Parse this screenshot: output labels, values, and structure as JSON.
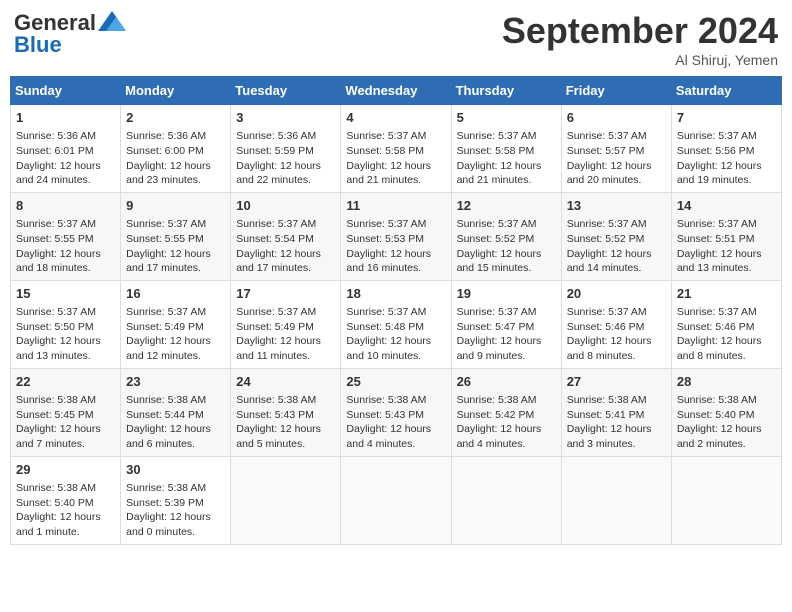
{
  "header": {
    "logo_general": "General",
    "logo_blue": "Blue",
    "month_title": "September 2024",
    "location": "Al Shiruj, Yemen"
  },
  "columns": [
    "Sunday",
    "Monday",
    "Tuesday",
    "Wednesday",
    "Thursday",
    "Friday",
    "Saturday"
  ],
  "weeks": [
    [
      {
        "day": "1",
        "sunrise": "Sunrise: 5:36 AM",
        "sunset": "Sunset: 6:01 PM",
        "daylight": "Daylight: 12 hours and 24 minutes."
      },
      {
        "day": "2",
        "sunrise": "Sunrise: 5:36 AM",
        "sunset": "Sunset: 6:00 PM",
        "daylight": "Daylight: 12 hours and 23 minutes."
      },
      {
        "day": "3",
        "sunrise": "Sunrise: 5:36 AM",
        "sunset": "Sunset: 5:59 PM",
        "daylight": "Daylight: 12 hours and 22 minutes."
      },
      {
        "day": "4",
        "sunrise": "Sunrise: 5:37 AM",
        "sunset": "Sunset: 5:58 PM",
        "daylight": "Daylight: 12 hours and 21 minutes."
      },
      {
        "day": "5",
        "sunrise": "Sunrise: 5:37 AM",
        "sunset": "Sunset: 5:58 PM",
        "daylight": "Daylight: 12 hours and 21 minutes."
      },
      {
        "day": "6",
        "sunrise": "Sunrise: 5:37 AM",
        "sunset": "Sunset: 5:57 PM",
        "daylight": "Daylight: 12 hours and 20 minutes."
      },
      {
        "day": "7",
        "sunrise": "Sunrise: 5:37 AM",
        "sunset": "Sunset: 5:56 PM",
        "daylight": "Daylight: 12 hours and 19 minutes."
      }
    ],
    [
      {
        "day": "8",
        "sunrise": "Sunrise: 5:37 AM",
        "sunset": "Sunset: 5:55 PM",
        "daylight": "Daylight: 12 hours and 18 minutes."
      },
      {
        "day": "9",
        "sunrise": "Sunrise: 5:37 AM",
        "sunset": "Sunset: 5:55 PM",
        "daylight": "Daylight: 12 hours and 17 minutes."
      },
      {
        "day": "10",
        "sunrise": "Sunrise: 5:37 AM",
        "sunset": "Sunset: 5:54 PM",
        "daylight": "Daylight: 12 hours and 17 minutes."
      },
      {
        "day": "11",
        "sunrise": "Sunrise: 5:37 AM",
        "sunset": "Sunset: 5:53 PM",
        "daylight": "Daylight: 12 hours and 16 minutes."
      },
      {
        "day": "12",
        "sunrise": "Sunrise: 5:37 AM",
        "sunset": "Sunset: 5:52 PM",
        "daylight": "Daylight: 12 hours and 15 minutes."
      },
      {
        "day": "13",
        "sunrise": "Sunrise: 5:37 AM",
        "sunset": "Sunset: 5:52 PM",
        "daylight": "Daylight: 12 hours and 14 minutes."
      },
      {
        "day": "14",
        "sunrise": "Sunrise: 5:37 AM",
        "sunset": "Sunset: 5:51 PM",
        "daylight": "Daylight: 12 hours and 13 minutes."
      }
    ],
    [
      {
        "day": "15",
        "sunrise": "Sunrise: 5:37 AM",
        "sunset": "Sunset: 5:50 PM",
        "daylight": "Daylight: 12 hours and 13 minutes."
      },
      {
        "day": "16",
        "sunrise": "Sunrise: 5:37 AM",
        "sunset": "Sunset: 5:49 PM",
        "daylight": "Daylight: 12 hours and 12 minutes."
      },
      {
        "day": "17",
        "sunrise": "Sunrise: 5:37 AM",
        "sunset": "Sunset: 5:49 PM",
        "daylight": "Daylight: 12 hours and 11 minutes."
      },
      {
        "day": "18",
        "sunrise": "Sunrise: 5:37 AM",
        "sunset": "Sunset: 5:48 PM",
        "daylight": "Daylight: 12 hours and 10 minutes."
      },
      {
        "day": "19",
        "sunrise": "Sunrise: 5:37 AM",
        "sunset": "Sunset: 5:47 PM",
        "daylight": "Daylight: 12 hours and 9 minutes."
      },
      {
        "day": "20",
        "sunrise": "Sunrise: 5:37 AM",
        "sunset": "Sunset: 5:46 PM",
        "daylight": "Daylight: 12 hours and 8 minutes."
      },
      {
        "day": "21",
        "sunrise": "Sunrise: 5:37 AM",
        "sunset": "Sunset: 5:46 PM",
        "daylight": "Daylight: 12 hours and 8 minutes."
      }
    ],
    [
      {
        "day": "22",
        "sunrise": "Sunrise: 5:38 AM",
        "sunset": "Sunset: 5:45 PM",
        "daylight": "Daylight: 12 hours and 7 minutes."
      },
      {
        "day": "23",
        "sunrise": "Sunrise: 5:38 AM",
        "sunset": "Sunset: 5:44 PM",
        "daylight": "Daylight: 12 hours and 6 minutes."
      },
      {
        "day": "24",
        "sunrise": "Sunrise: 5:38 AM",
        "sunset": "Sunset: 5:43 PM",
        "daylight": "Daylight: 12 hours and 5 minutes."
      },
      {
        "day": "25",
        "sunrise": "Sunrise: 5:38 AM",
        "sunset": "Sunset: 5:43 PM",
        "daylight": "Daylight: 12 hours and 4 minutes."
      },
      {
        "day": "26",
        "sunrise": "Sunrise: 5:38 AM",
        "sunset": "Sunset: 5:42 PM",
        "daylight": "Daylight: 12 hours and 4 minutes."
      },
      {
        "day": "27",
        "sunrise": "Sunrise: 5:38 AM",
        "sunset": "Sunset: 5:41 PM",
        "daylight": "Daylight: 12 hours and 3 minutes."
      },
      {
        "day": "28",
        "sunrise": "Sunrise: 5:38 AM",
        "sunset": "Sunset: 5:40 PM",
        "daylight": "Daylight: 12 hours and 2 minutes."
      }
    ],
    [
      {
        "day": "29",
        "sunrise": "Sunrise: 5:38 AM",
        "sunset": "Sunset: 5:40 PM",
        "daylight": "Daylight: 12 hours and 1 minute."
      },
      {
        "day": "30",
        "sunrise": "Sunrise: 5:38 AM",
        "sunset": "Sunset: 5:39 PM",
        "daylight": "Daylight: 12 hours and 0 minutes."
      },
      null,
      null,
      null,
      null,
      null
    ]
  ]
}
